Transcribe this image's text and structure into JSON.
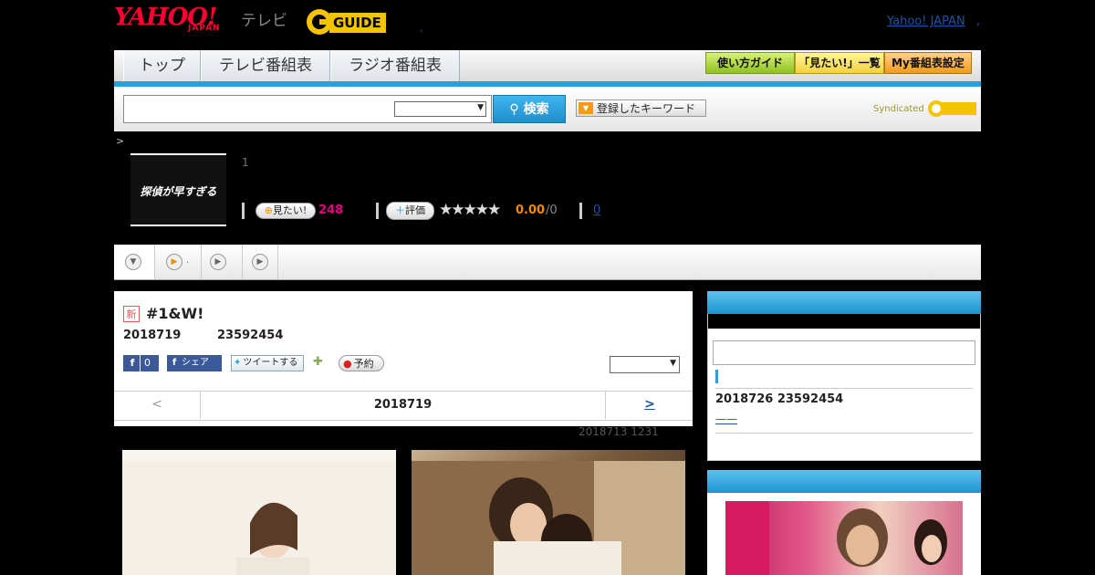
{
  "header": {
    "yahoo_logo": "YAHOO!",
    "japan_logo": "JAPAN",
    "tv_logo": "テレビ",
    "gguide_logo": "GUIDE",
    "yahoo_japan_link": "Yahoo! JAPAN",
    "dot1": ",",
    "dot2": ","
  },
  "global_nav": {
    "tabs": [
      "トップ",
      "テレビ番組表",
      "ラジオ番組表"
    ],
    "buttons": [
      "使い方ガイド",
      "「見たい!」一覧",
      "My番組表設定"
    ]
  },
  "search": {
    "button_label": "検索",
    "keyword_button": "登録したキーワード",
    "syndicated": "Syndicated"
  },
  "program": {
    "breadcrumb": ">",
    "thumb_text": "探偵が早すぎる",
    "episode_count": "1",
    "mitai_label": "見たい!",
    "mitai_count": "248",
    "hyoka_label": "評価",
    "stars": "★★★★★",
    "rating": "0.00",
    "rating_count": "/0",
    "review_link": "0"
  },
  "sub_tabs": [
    ".",
    "",
    ""
  ],
  "episode": {
    "new_badge": "新",
    "title": "#1&W!",
    "date": "2018719",
    "time": "23592454",
    "fb_like_count": "0",
    "fb_share_label": "シェア",
    "tweet_label": "ツイートする",
    "reserve_label": "予約",
    "prev_label": "<",
    "pager_date": "2018719",
    "next_label": ">",
    "updated": "2018713  1231"
  },
  "sidebar": {
    "next_date": "2018726  23592454",
    "link_text": "——"
  },
  "colors": {
    "accent_blue": "#2aa0de",
    "yahoo_red": "#ff0033",
    "mitai_pink": "#e4007f",
    "rating_orange": "#f08c00"
  }
}
